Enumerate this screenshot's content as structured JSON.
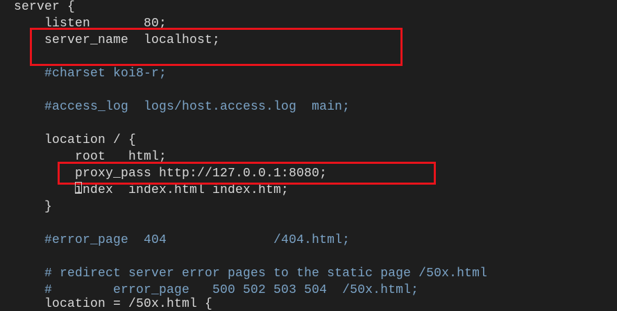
{
  "code_lines": [
    {
      "text": "server {",
      "type": "code"
    },
    {
      "text": "    listen       80;",
      "type": "code"
    },
    {
      "text": "    server_name  localhost;",
      "type": "code"
    },
    {
      "text": "",
      "type": "blank"
    },
    {
      "text": "    #charset koi8-r;",
      "type": "comment"
    },
    {
      "text": "",
      "type": "blank"
    },
    {
      "text": "    #access_log  logs/host.access.log  main;",
      "type": "comment"
    },
    {
      "text": "",
      "type": "blank"
    },
    {
      "text": "    location / {",
      "type": "code"
    },
    {
      "text": "        root   html;",
      "type": "code"
    },
    {
      "text": "        proxy_pass http://127.0.0.1:8080;",
      "type": "code"
    },
    {
      "text": "        index  index.html index.htm;",
      "type": "code"
    },
    {
      "text": "    }",
      "type": "code"
    },
    {
      "text": "",
      "type": "blank"
    },
    {
      "text": "    #error_page  404              /404.html;",
      "type": "comment"
    },
    {
      "text": "",
      "type": "blank"
    },
    {
      "text": "    # redirect server error pages to the static page /50x.html",
      "type": "comment"
    },
    {
      "text": "    #        error_page   500 502 503 504  /50x.html;",
      "type": "comment"
    },
    {
      "text": "    location = /50x.html {",
      "type": "code"
    }
  ],
  "highlight_color": "#e8131b"
}
